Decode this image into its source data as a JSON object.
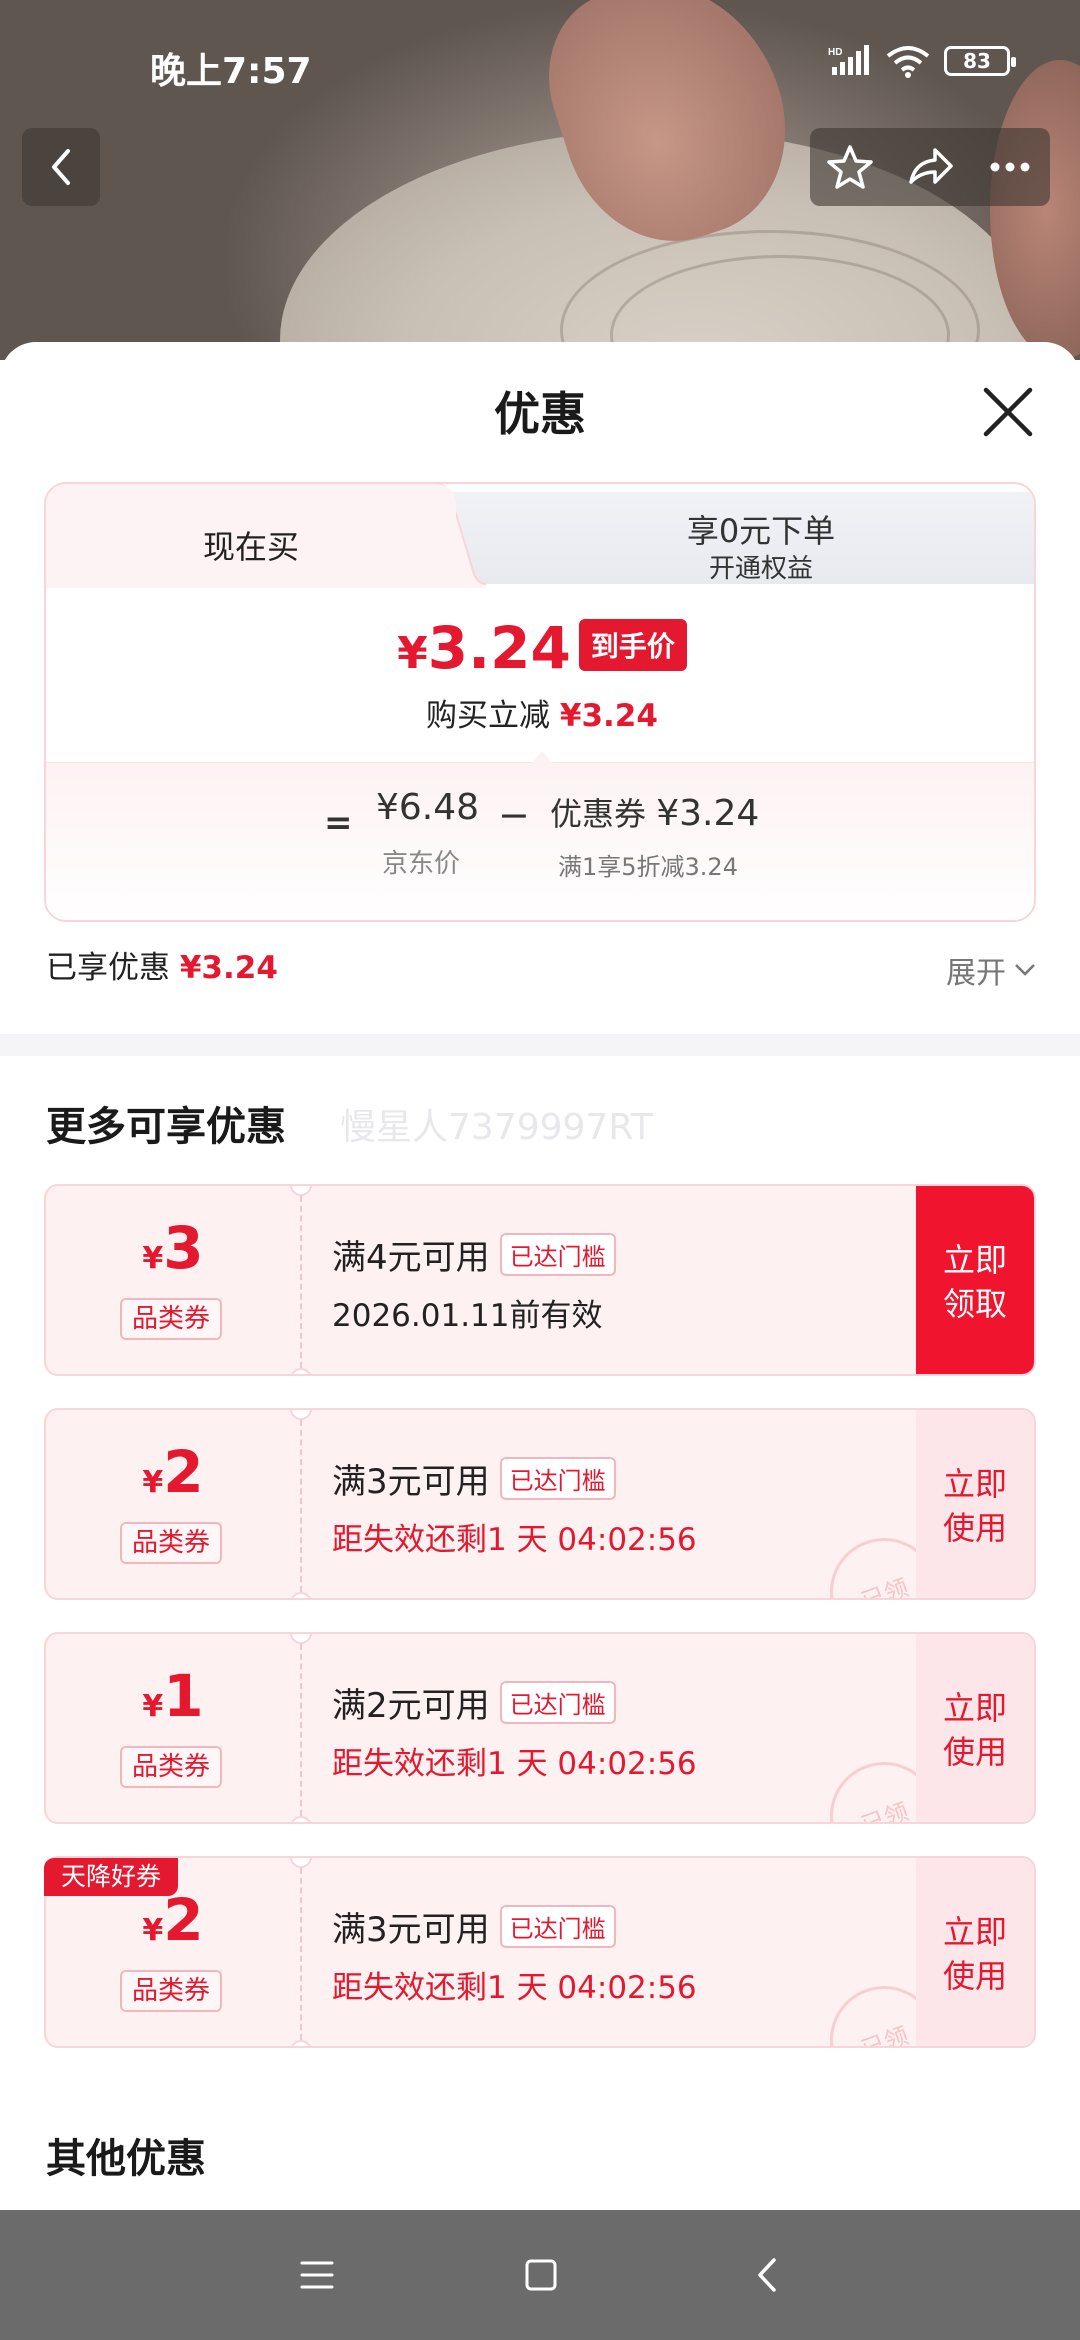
{
  "status_bar": {
    "time": "晚上7:57",
    "battery": "83"
  },
  "sheet": {
    "title": "优惠",
    "tabs": {
      "now": "现在买",
      "zero_title": "享0元下单",
      "zero_sub": "开通权益"
    },
    "final_price": {
      "currency": "¥",
      "value": "3.24",
      "tag": "到手价"
    },
    "reduce_line": {
      "label": "购买立减",
      "amount": "¥3.24"
    },
    "calc": {
      "equals": "=",
      "jd_price": "¥6.48",
      "jd_label": "京东价",
      "minus": "−",
      "coupon_label": "优惠券",
      "coupon_value": "¥3.24",
      "coupon_desc": "满1享5折减3.24"
    },
    "enjoyed": {
      "label": "已享优惠",
      "amount": "¥3.24"
    },
    "expand_label": "展开"
  },
  "more_section": {
    "title": "更多可享优惠",
    "watermark": "慢星人7379997RT"
  },
  "coupons": [
    {
      "currency": "¥",
      "amount": "3",
      "type": "品类券",
      "condition": "满4元可用",
      "badge": "已达门槛",
      "validity": "2026.01.11前有效",
      "action": "立即\n领取",
      "claimed": false
    },
    {
      "currency": "¥",
      "amount": "2",
      "type": "品类券",
      "condition": "满3元可用",
      "badge": "已达门槛",
      "validity": "距失效还剩1 天 04:02:56",
      "action": "立即\n使用",
      "claimed": true,
      "stamp": "已领"
    },
    {
      "currency": "¥",
      "amount": "1",
      "type": "品类券",
      "condition": "满2元可用",
      "badge": "已达门槛",
      "validity": "距失效还剩1 天 04:02:56",
      "action": "立即\n使用",
      "claimed": true,
      "stamp": "已领"
    },
    {
      "currency": "¥",
      "amount": "2",
      "type": "品类券",
      "condition": "满3元可用",
      "badge": "已达门槛",
      "validity": "距失效还剩1 天 04:02:56",
      "action": "立即\n使用",
      "claimed": true,
      "stamp": "已领",
      "corner_tag": "天降好券"
    }
  ],
  "other_section": {
    "title": "其他优惠"
  },
  "colors": {
    "accent": "#e4192f",
    "coupon_bg": "#fdf1f2",
    "nav_bg": "#6b6b6b"
  },
  "icons": [
    "back-icon",
    "star-icon",
    "share-icon",
    "more-icon",
    "close-icon",
    "chevron-down-icon",
    "menu-icon",
    "home-icon",
    "nav-back-icon",
    "signal-icon",
    "wifi-icon",
    "battery-icon"
  ]
}
